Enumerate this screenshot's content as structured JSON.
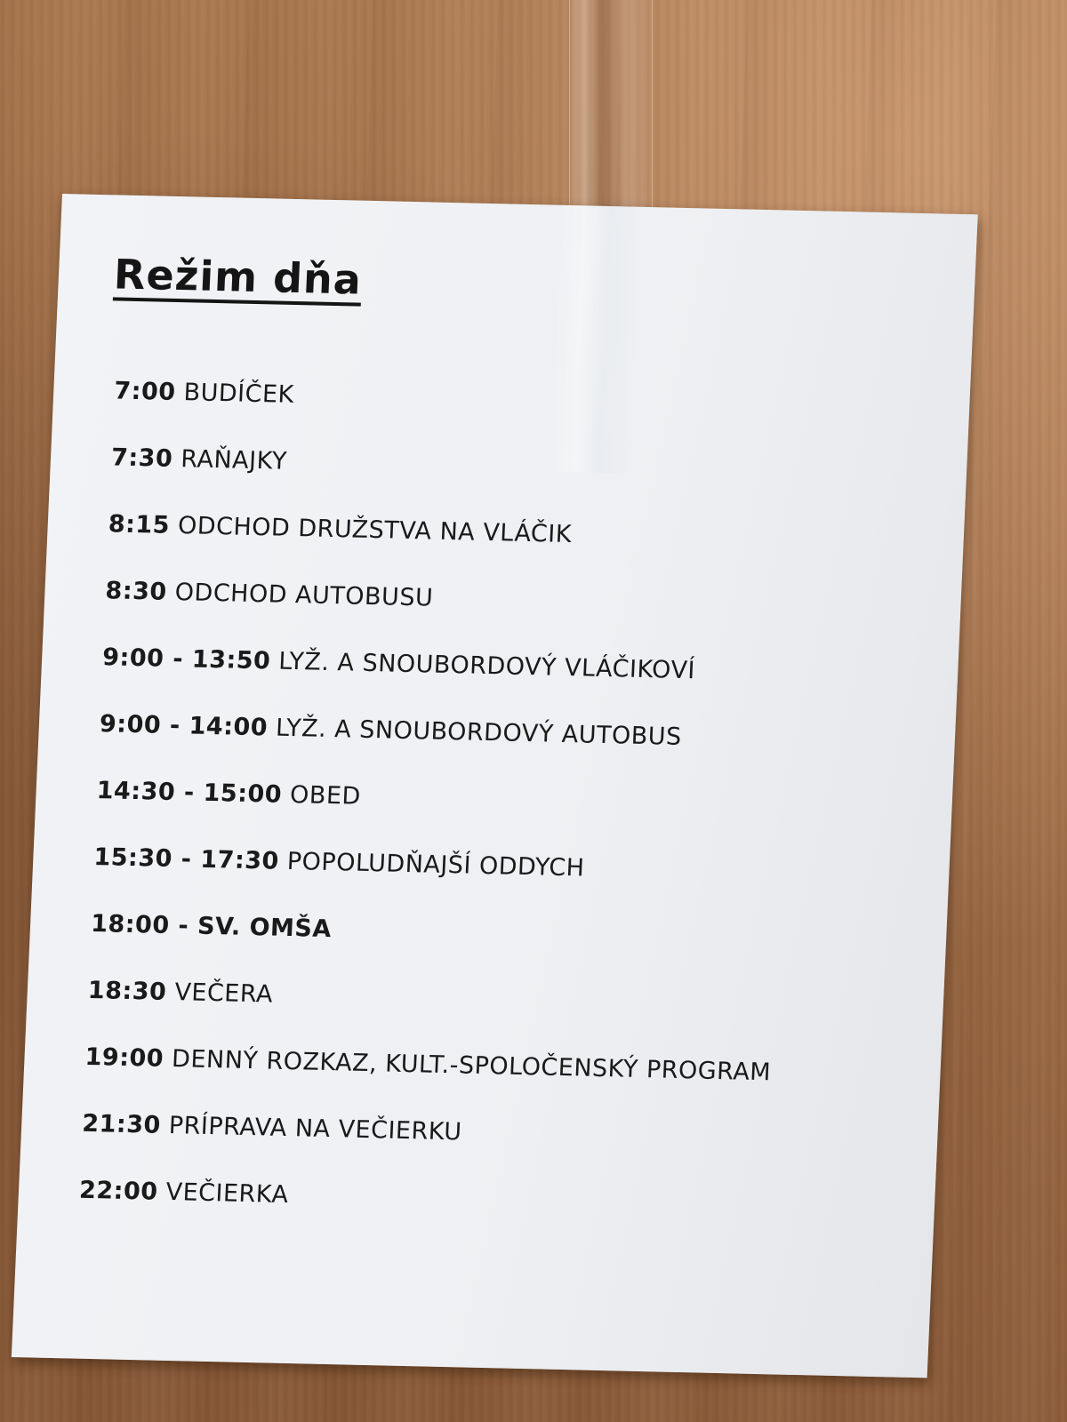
{
  "notice": {
    "title": "Režim dňa",
    "schedule": [
      {
        "time": "7:00",
        "activity": "BUDÍČEK"
      },
      {
        "time": "7:30",
        "activity": "RAŇAJKY"
      },
      {
        "time": "8:15",
        "activity": "ODCHOD DRUŽSTVA NA VLÁČIK"
      },
      {
        "time": "8:30",
        "activity": "ODCHOD AUTOBUSU"
      },
      {
        "time": "9:00 - 13:50",
        "activity": "LYŽ. A SNOUBORDOVÝ VLÁČIKOVÍ"
      },
      {
        "time": "9:00 - 14:00",
        "activity": "LYŽ. A SNOUBORDOVÝ AUTOBUS"
      },
      {
        "time": "14:30 - 15:00",
        "activity": "OBED"
      },
      {
        "time": "15:30 - 17:30",
        "activity": "POPOLUDŇAJŠÍ ODDYCH"
      },
      {
        "time": "18:00 - SV. OMŠA",
        "activity": ""
      },
      {
        "time": "18:30",
        "activity": "VEČERA"
      },
      {
        "time": "19:00",
        "activity": "DENNÝ ROZKAZ, KULT.-SPOLOČENSKÝ PROGRAM"
      },
      {
        "time": "21:30",
        "activity": "PRÍPRAVA NA VEČIERKU"
      },
      {
        "time": "22:00",
        "activity": "VEČIERKA"
      }
    ]
  },
  "colors": {
    "wood": "#a06e48",
    "paper": "#eef0f3",
    "ink": "#1a1a1a"
  }
}
